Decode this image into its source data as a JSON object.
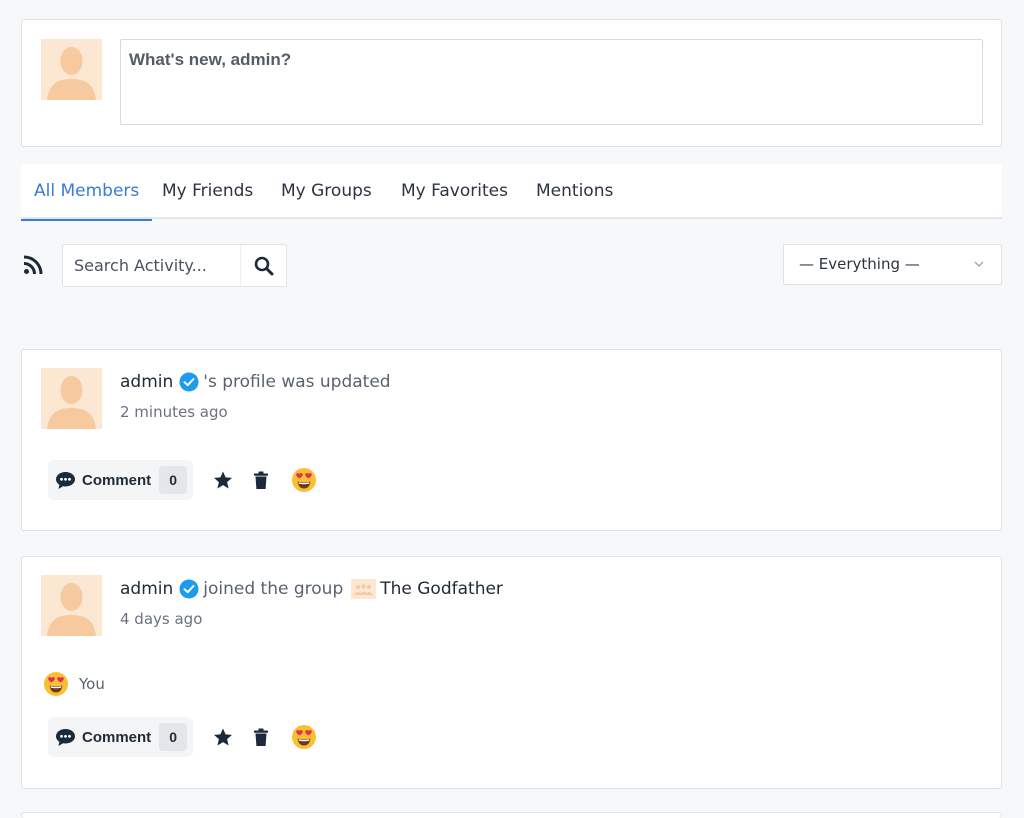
{
  "post_box": {
    "placeholder": "What's new, admin?"
  },
  "tabs": [
    {
      "label": "All Members",
      "active": true
    },
    {
      "label": "My Friends",
      "active": false
    },
    {
      "label": "My Groups",
      "active": false
    },
    {
      "label": "My Favorites",
      "active": false
    },
    {
      "label": "Mentions",
      "active": false
    }
  ],
  "filter": {
    "search_placeholder": "Search Activity...",
    "select_value": "— Everything —"
  },
  "activities": [
    {
      "user": "admin",
      "action": "'s profile was updated",
      "time": "2 minutes ago",
      "comment_label": "Comment",
      "comment_count": "0"
    },
    {
      "user": "admin",
      "action": "joined the group",
      "group": "The Godfather",
      "time": "4 days ago",
      "reaction_by": "You",
      "comment_label": "Comment",
      "comment_count": "0"
    }
  ],
  "colors": {
    "accent": "#3a7bd5",
    "verified": "#1d9bf0",
    "icon_dark": "#1b2a3a"
  }
}
